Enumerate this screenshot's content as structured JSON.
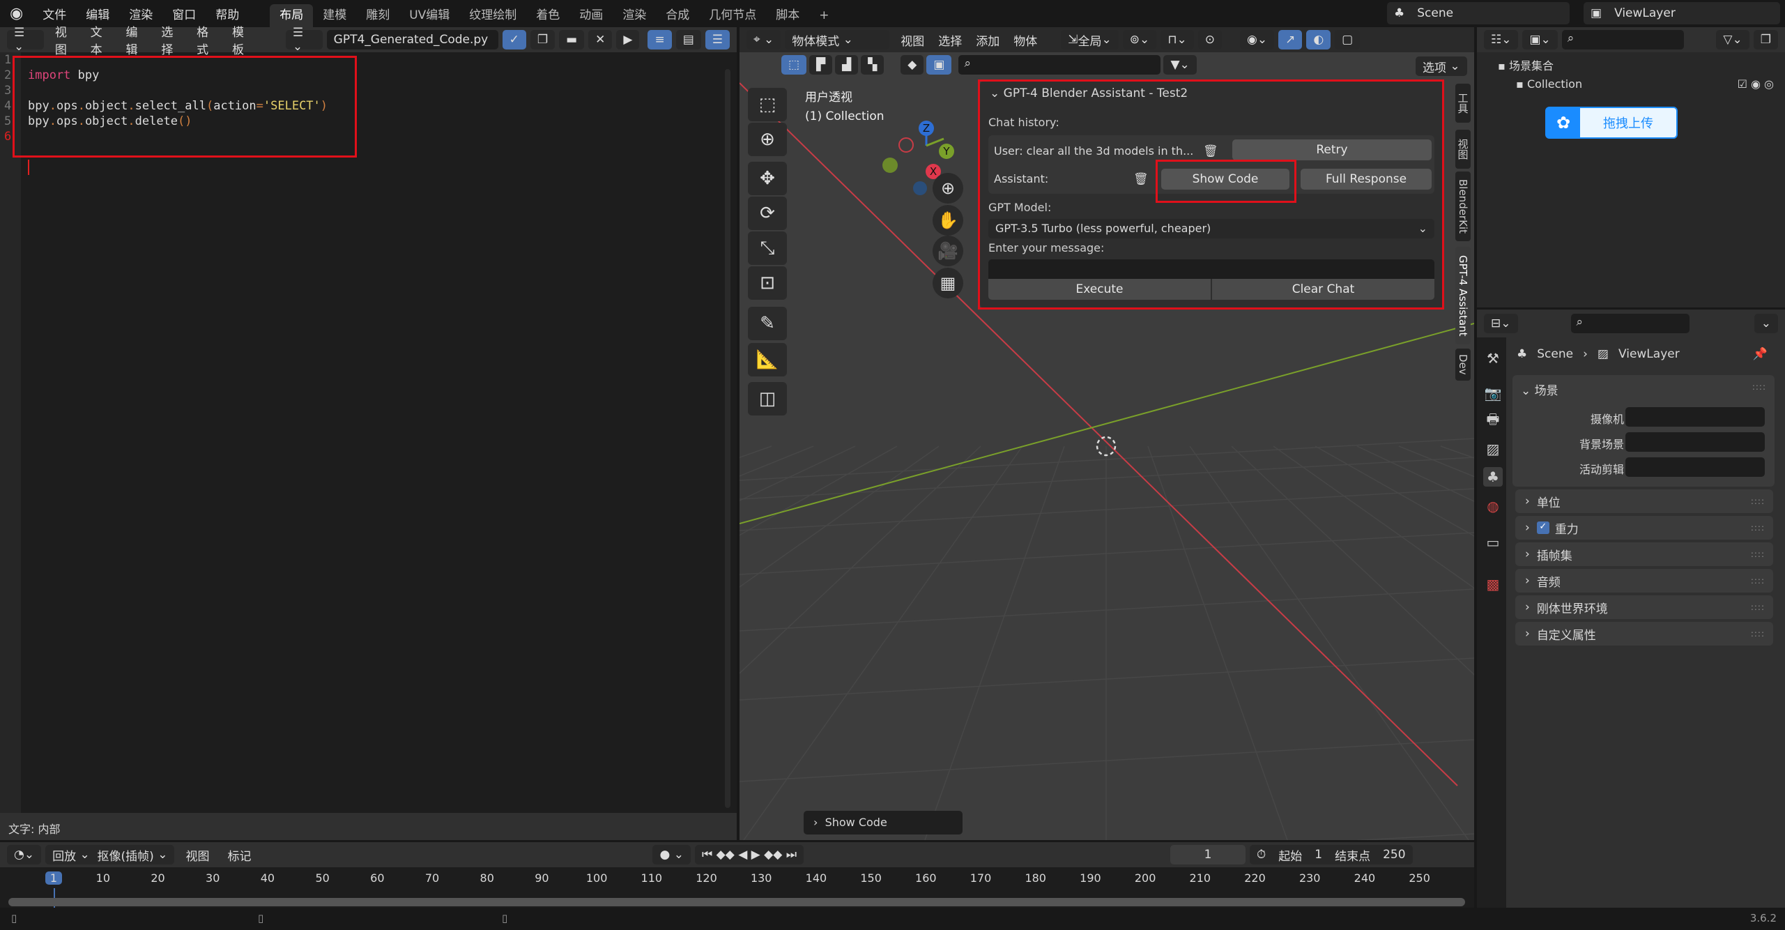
{
  "topbar": {
    "menus": [
      "文件",
      "编辑",
      "渲染",
      "窗口",
      "帮助"
    ],
    "workspaces": [
      "布局",
      "建模",
      "雕刻",
      "UV编辑",
      "纹理绘制",
      "着色",
      "动画",
      "渲染",
      "合成",
      "几何节点",
      "脚本"
    ],
    "active_workspace": "布局",
    "add": "+",
    "scene": "Scene",
    "view_layer": "ViewLayer"
  },
  "text_editor": {
    "menus": [
      "视图",
      "文本",
      "编辑",
      "选择",
      "格式",
      "模板"
    ],
    "filename": "GPT4_Generated_Code.py",
    "line_numbers": [
      "1",
      "2",
      "3",
      "4",
      "5",
      "6"
    ],
    "lines": [
      [],
      [
        {
          "t": "import",
          "c": "#e0457b"
        },
        {
          "t": " bpy",
          "c": "#dddddd"
        }
      ],
      [],
      [
        {
          "t": "bpy",
          "c": "#ddd"
        },
        {
          "t": ".",
          "c": "#d08040"
        },
        {
          "t": "ops",
          "c": "#ddd"
        },
        {
          "t": ".",
          "c": "#d08040"
        },
        {
          "t": "object",
          "c": "#ddd"
        },
        {
          "t": ".",
          "c": "#d08040"
        },
        {
          "t": "select_all",
          "c": "#ddd"
        },
        {
          "t": "(",
          "c": "#d08040"
        },
        {
          "t": "action",
          "c": "#ddd"
        },
        {
          "t": "=",
          "c": "#d08040"
        },
        {
          "t": "'SELECT'",
          "c": "#e8d26a"
        },
        {
          "t": ")",
          "c": "#d08040"
        }
      ],
      [
        {
          "t": "bpy",
          "c": "#ddd"
        },
        {
          "t": ".",
          "c": "#d08040"
        },
        {
          "t": "ops",
          "c": "#ddd"
        },
        {
          "t": ".",
          "c": "#d08040"
        },
        {
          "t": "object",
          "c": "#ddd"
        },
        {
          "t": ".",
          "c": "#d08040"
        },
        {
          "t": "delete",
          "c": "#ddd"
        },
        {
          "t": "()",
          "c": "#d08040"
        }
      ],
      []
    ],
    "status": "文字: 内部"
  },
  "viewport": {
    "mode": "物体模式",
    "menus": [
      "视图",
      "选择",
      "添加",
      "物体"
    ],
    "transform": "全局",
    "options": "选项",
    "view_name": "用户透视",
    "collection": "(1) Collection",
    "gizmo": {
      "z": "Z",
      "y": "Y",
      "x": "X"
    },
    "last_op": "Show Code",
    "side_tabs": [
      "工具",
      "视图",
      "BlenderKit",
      "GPT-4 Assistant",
      "Dev"
    ],
    "active_tab": "GPT-4 Assistant",
    "axis_colors": {
      "x": "#c83c46",
      "y": "#7aa02a",
      "z": "#2d6ed4"
    }
  },
  "gpt_panel": {
    "title": "GPT-4 Blender Assistant - Test2",
    "chat_history_label": "Chat history:",
    "user_message": "User: clear all the 3d models in th...",
    "retry": "Retry",
    "assistant_label": "Assistant:",
    "show_code": "Show Code",
    "full_response": "Full Response",
    "model_label": "GPT Model:",
    "model_value": "GPT-3.5 Turbo (less powerful, cheaper)",
    "message_label": "Enter your message:",
    "message_value": "",
    "execute": "Execute",
    "clear_chat": "Clear Chat"
  },
  "outliner": {
    "scene_collection": "场景集合",
    "collection": "Collection",
    "upload_button": "拖拽上传"
  },
  "properties": {
    "breadcrumb_scene": "Scene",
    "breadcrumb_viewlayer": "ViewLayer",
    "scene_section": "场景",
    "fields": [
      {
        "label": "摄像机"
      },
      {
        "label": "背景场景"
      },
      {
        "label": "活动剪辑"
      }
    ],
    "sections": [
      {
        "label": "单位",
        "checkbox": false
      },
      {
        "label": "重力",
        "checkbox": true
      },
      {
        "label": "插帧集",
        "checkbox": false
      },
      {
        "label": "音频",
        "checkbox": false
      },
      {
        "label": "刚体世界环境",
        "checkbox": false
      },
      {
        "label": "自定义属性",
        "checkbox": false
      }
    ]
  },
  "timeline": {
    "playback": "回放",
    "keying": "抠像(插帧)",
    "view": "视图",
    "marker": "标记",
    "current_frame": "1",
    "start_label": "起始",
    "start": "1",
    "end_label": "结束点",
    "end": "250",
    "ticks": [
      1,
      10,
      20,
      30,
      40,
      50,
      60,
      70,
      80,
      90,
      100,
      110,
      120,
      130,
      140,
      150,
      160,
      170,
      180,
      190,
      200,
      210,
      220,
      230,
      240,
      250
    ]
  },
  "statusbar": {
    "version": "3.6.2"
  }
}
